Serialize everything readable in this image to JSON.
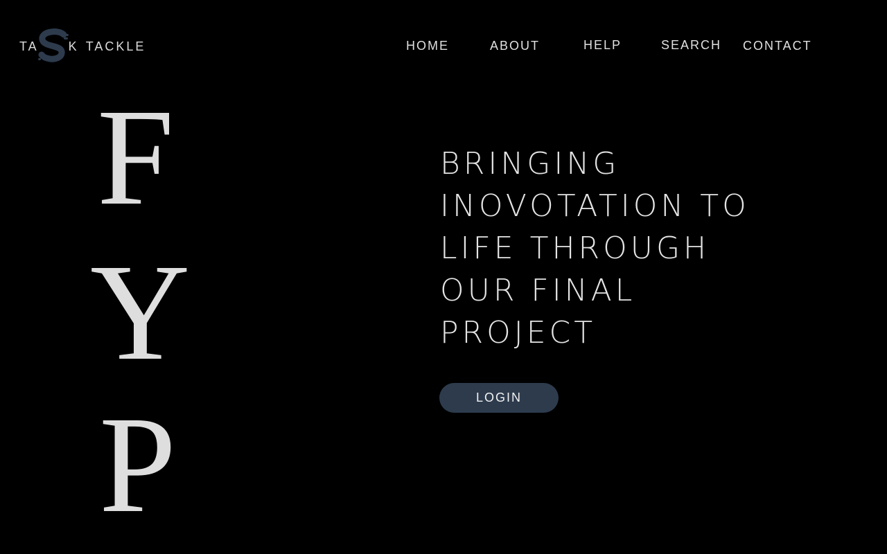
{
  "brand": {
    "prefix": "TA",
    "middle": "K",
    "suffix": "TACKLE",
    "mark_icon": "s-swoosh-logo-icon",
    "mark_color": "#2d3b4d"
  },
  "nav": {
    "items": [
      {
        "label": "HOME"
      },
      {
        "label": "ABOUT"
      },
      {
        "label": "HELP"
      },
      {
        "label": "SEARCH"
      },
      {
        "label": "CONTACT"
      }
    ]
  },
  "hero": {
    "letters": [
      "F",
      "Y",
      "P"
    ],
    "headline_lines": [
      "BRINGING",
      "INOVOTATION TO",
      "LIFE THROUGH",
      "OUR FINAL",
      "PROJECT"
    ],
    "login_label": "LOGIN"
  },
  "colors": {
    "background": "#000000",
    "text": "#e2e2e2",
    "accent": "#2d3b4d"
  }
}
